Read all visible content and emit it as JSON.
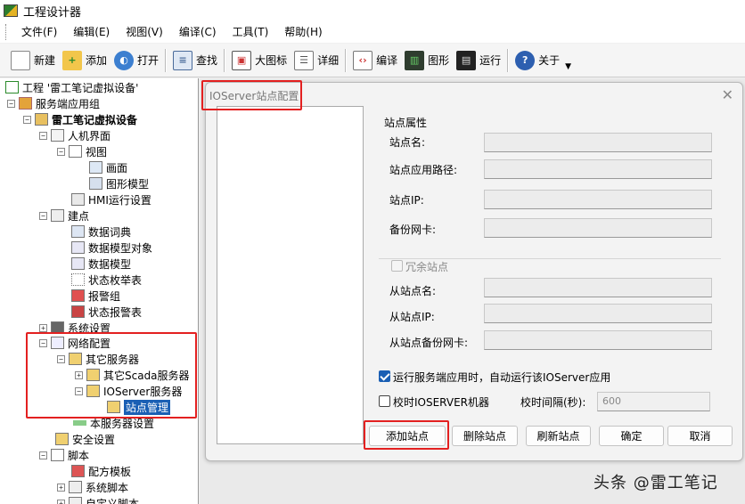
{
  "window": {
    "title": "工程设计器"
  },
  "menu": [
    "文件(F)",
    "编辑(E)",
    "视图(V)",
    "编译(C)",
    "工具(T)",
    "帮助(H)"
  ],
  "toolbar": {
    "new": "新建",
    "add": "添加",
    "open": "打开",
    "find": "查找",
    "large_icons": "大图标",
    "details": "详细",
    "compile": "编译",
    "graphics": "图形",
    "run": "运行",
    "about": "关于"
  },
  "tree": [
    "工程 '雷工笔记虚拟设备'",
    "服务端应用组",
    "雷工笔记虚拟设备",
    "人机界面",
    "视图",
    "画面",
    "图形模型",
    "HMI运行设置",
    "建点",
    "数据词典",
    "数据模型对象",
    "数据模型",
    "状态枚举表",
    "报警组",
    "状态报警表",
    "系统设置",
    "网络配置",
    "其它服务器",
    "其它Scada服务器",
    "IOServer服务器",
    "站点管理",
    "本服务器设置",
    "安全设置",
    "脚本",
    "配方模板",
    "系统脚本",
    "自定义脚本"
  ],
  "dialog": {
    "title": "IOServer站点配置",
    "group_title": "站点属性",
    "labels": {
      "site_name": "站点名:",
      "site_app_path": "站点应用路径:",
      "site_ip": "站点IP:",
      "backup_nic": "备份网卡:",
      "redundant": "冗余站点",
      "slave_name": "从站点名:",
      "slave_ip": "从站点IP:",
      "slave_backup_nic": "从站点备份网卡:"
    },
    "auto_run_label": "运行服务端应用时，自动运行该IOServer应用",
    "auto_run_checked": true,
    "time_sync_label": "校时IOSERVER机器",
    "time_sync_checked": false,
    "interval_label": "校时间隔(秒):",
    "interval_value": "600",
    "buttons": {
      "add": "添加站点",
      "delete": "删除站点",
      "refresh": "刷新站点",
      "ok": "确定",
      "cancel": "取消"
    }
  },
  "watermark": "头条 @雷工笔记"
}
